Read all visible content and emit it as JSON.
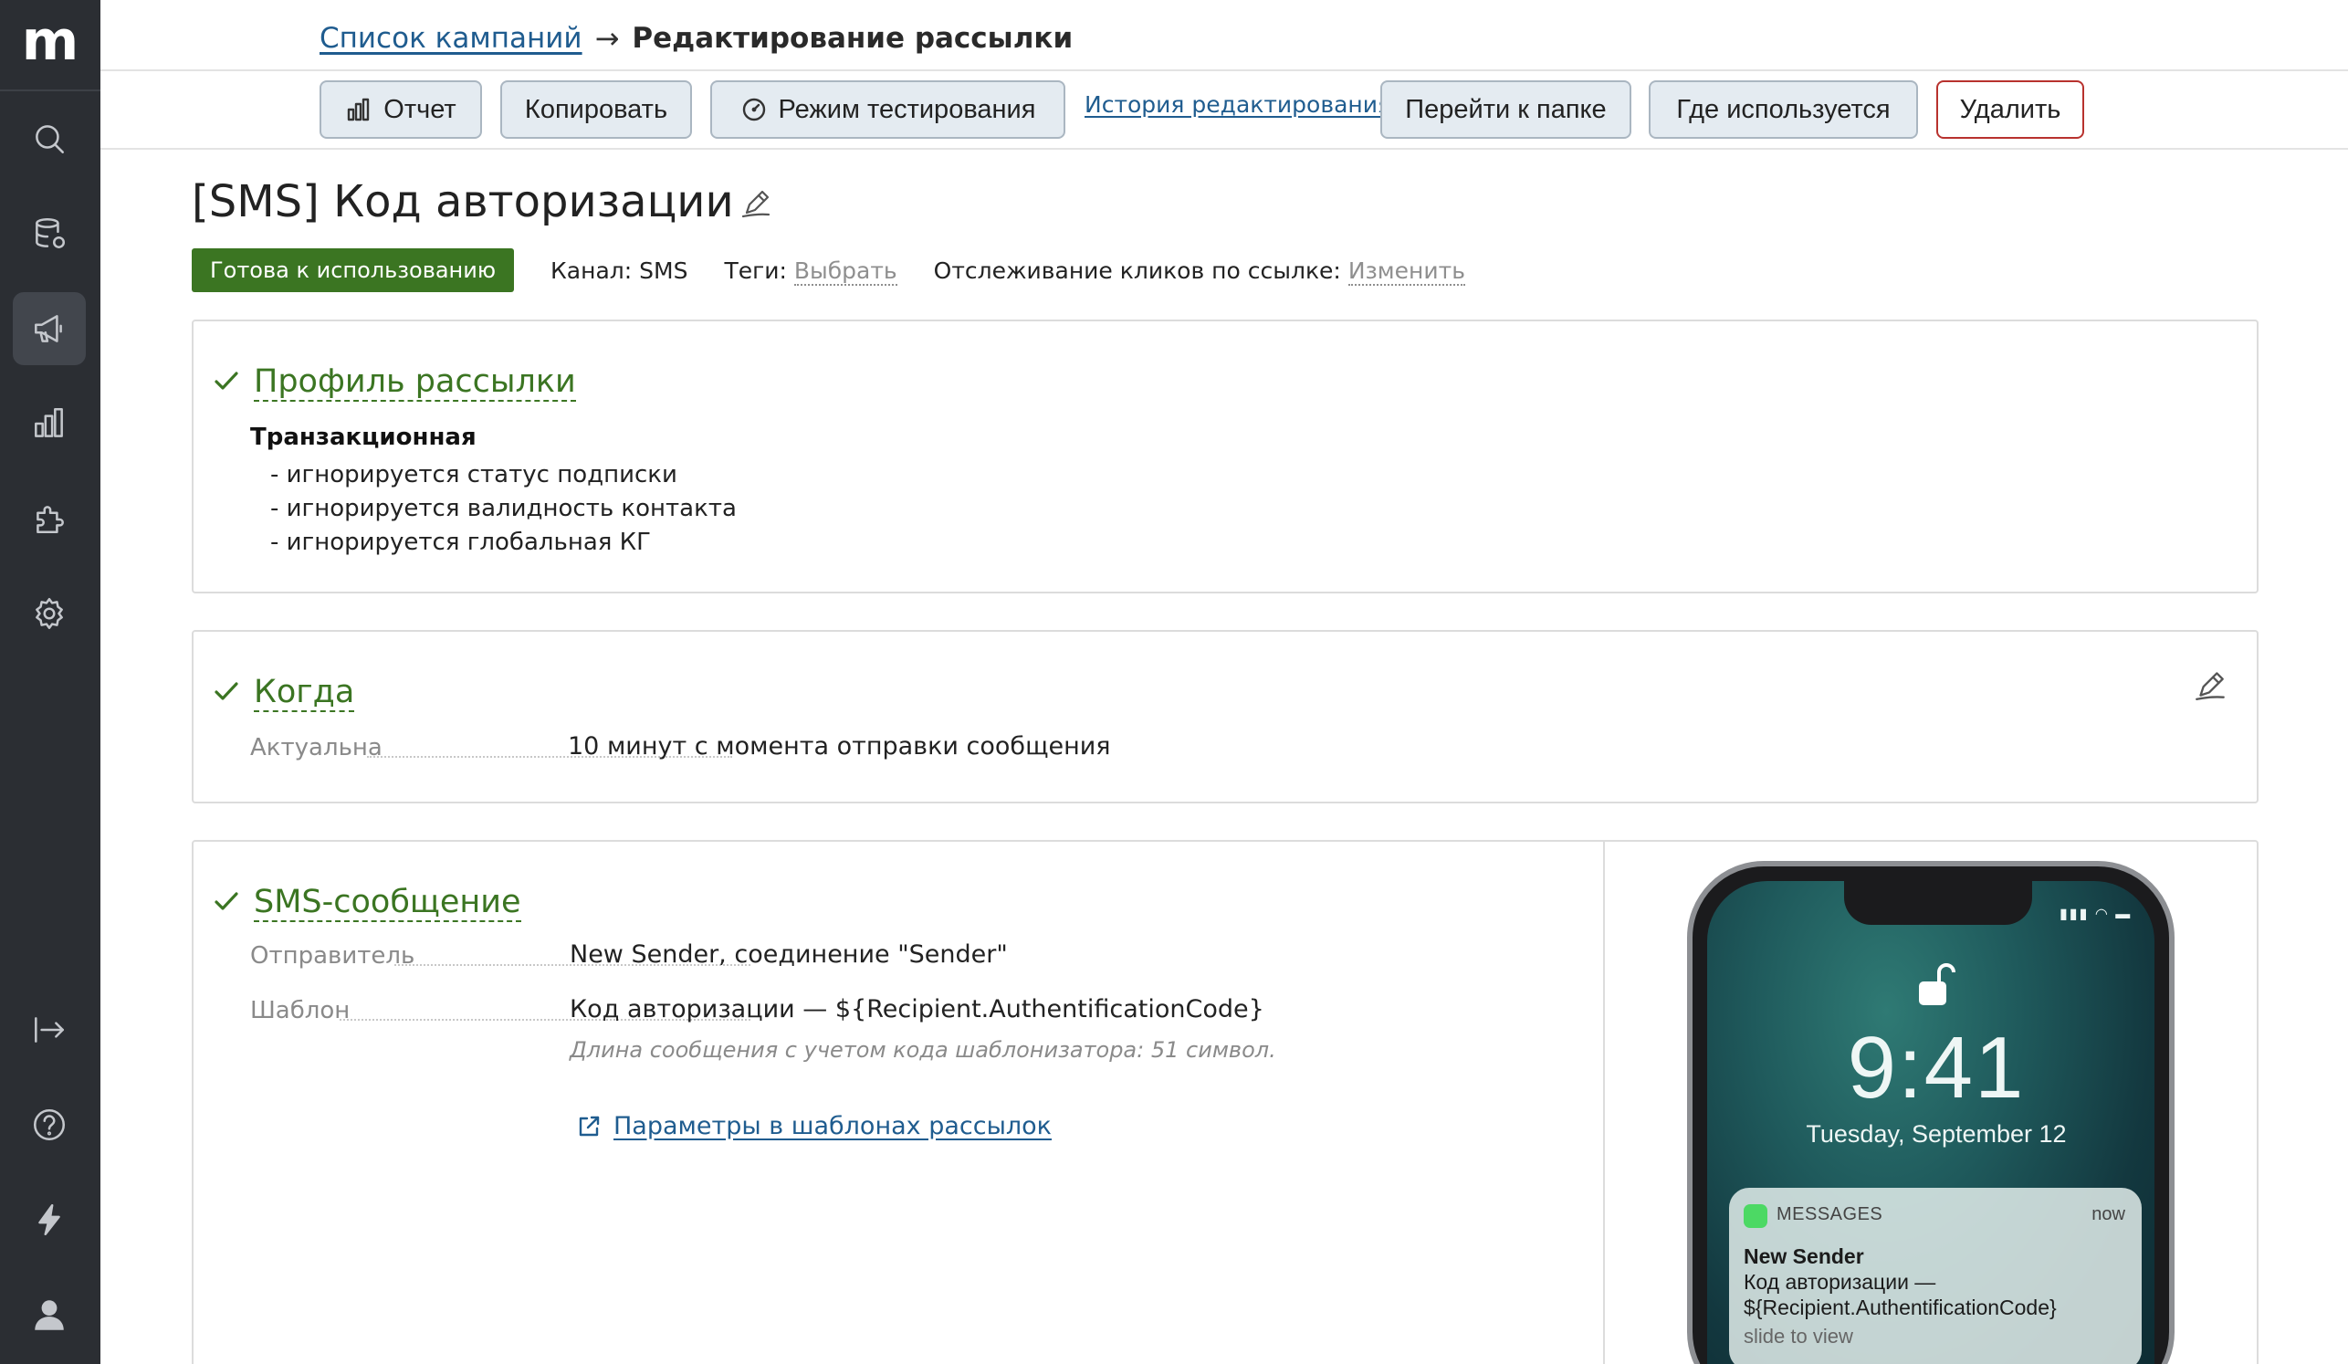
{
  "sidebar": {
    "logo": "m",
    "items": [
      {
        "icon": "search-icon"
      },
      {
        "icon": "database-icon"
      },
      {
        "icon": "megaphone-icon",
        "active": true
      },
      {
        "icon": "bar-chart-icon"
      },
      {
        "icon": "puzzle-icon"
      },
      {
        "icon": "gear-icon"
      }
    ],
    "bottom_items": [
      {
        "icon": "collapse-arrow-icon"
      },
      {
        "icon": "help-icon"
      },
      {
        "icon": "lightning-icon"
      },
      {
        "icon": "user-icon"
      }
    ]
  },
  "breadcrumb": {
    "parent": "Список кампаний",
    "separator": "→",
    "current": "Редактирование рассылки"
  },
  "toolbar": {
    "report": "Отчет",
    "copy": "Копировать",
    "test_mode": "Режим тестирования",
    "history": "История редактирования",
    "go_to_folder": "Перейти к папке",
    "where_used": "Где используется",
    "delete": "Удалить"
  },
  "title": "[SMS] Код авторизации",
  "status": {
    "badge": "Готова к использованию",
    "channel_label": "Канал:",
    "channel_value": "SMS",
    "tags_label": "Теги:",
    "tags_link": "Выбрать",
    "tracking_label": "Отслеживание кликов по ссылке:",
    "tracking_link": "Изменить"
  },
  "profile": {
    "title": "Профиль рассылки",
    "type": "Транзакционная",
    "rules": [
      "- игнорируется статус подписки",
      "- игнорируется валидность контакта",
      "- игнорируется глобальная КГ"
    ]
  },
  "when": {
    "title": "Когда",
    "actual_label": "Актуальна",
    "actual_value": "10 минут с момента отправки сообщения"
  },
  "sms": {
    "title": "SMS-сообщение",
    "sender_label": "Отправитель",
    "sender_value": "New Sender, соединение \"Sender\"",
    "template_label": "Шаблон",
    "template_value": "Код авторизации — ${Recipient.AuthentificationCode}",
    "length_note": "Длина сообщения с учетом кода шаблонизатора: 51 символ.",
    "params_link": "Параметры в шаблонах рассылок"
  },
  "phone": {
    "time": "9:41",
    "date": "Tuesday, September 12",
    "notif_app": "MESSAGES",
    "notif_time": "now",
    "notif_sender": "New Sender",
    "notif_line1": "Код авторизации —",
    "notif_line2": "${Recipient.AuthentificationCode}",
    "notif_hint": "slide to view"
  },
  "colors": {
    "sidebar_bg": "#2b2e33",
    "accent_green": "#3b7522",
    "link_blue": "#1f5c8f",
    "button_bg": "#e4ebf1",
    "danger_border": "#b8322e"
  }
}
